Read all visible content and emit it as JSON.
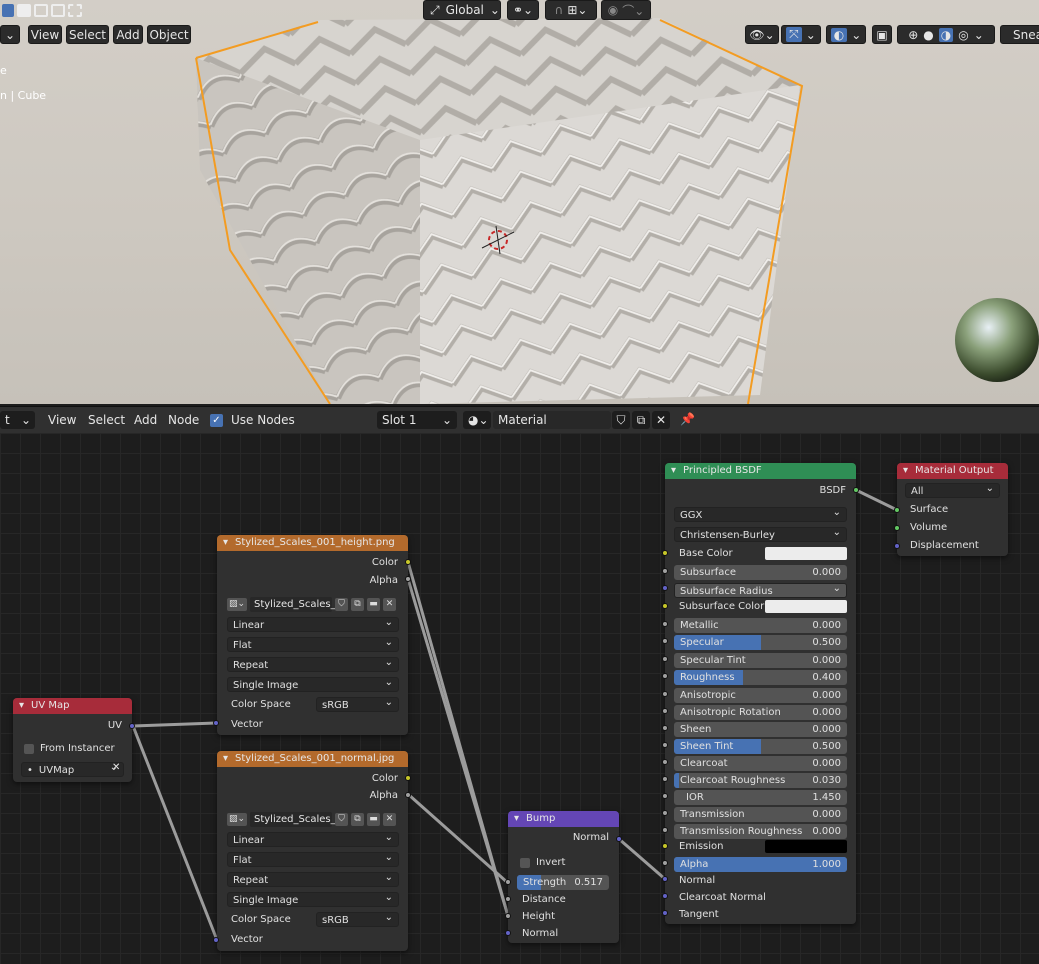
{
  "viewport": {
    "transform_orientation": "Global",
    "menu": [
      "View",
      "Select",
      "Add",
      "Object"
    ],
    "overlay_lines": [
      "e",
      "n | Cube"
    ],
    "shading_label": "Snea"
  },
  "editor": {
    "editor_type": "t",
    "menu": [
      "View",
      "Select",
      "Add",
      "Node"
    ],
    "use_nodes_label": "Use Nodes",
    "use_nodes_checked": true,
    "slot": "Slot 1",
    "material_name": "Material"
  },
  "nodes": {
    "uvmap": {
      "title": "UV Map",
      "out_uv": "UV",
      "from_instancer": "From Instancer",
      "uvmap_value": "UVMap"
    },
    "tex_height": {
      "title": "Stylized_Scales_001_height.png",
      "out_color": "Color",
      "out_alpha": "Alpha",
      "image": "Stylized_Scales_0..",
      "interpolation": "Linear",
      "projection": "Flat",
      "extension": "Repeat",
      "source": "Single Image",
      "color_space_label": "Color Space",
      "color_space": "sRGB",
      "in_vector": "Vector"
    },
    "tex_normal": {
      "title": "Stylized_Scales_001_normal.jpg",
      "out_color": "Color",
      "out_alpha": "Alpha",
      "image": "Stylized_Scales_0..",
      "interpolation": "Linear",
      "projection": "Flat",
      "extension": "Repeat",
      "source": "Single Image",
      "color_space_label": "Color Space",
      "color_space": "sRGB",
      "in_vector": "Vector"
    },
    "bump": {
      "title": "Bump",
      "out_normal": "Normal",
      "invert": "Invert",
      "strength_label": "Strength",
      "strength": "0.517",
      "strength_fraction": 0.517,
      "distance": "Distance",
      "height": "Height",
      "normal": "Normal"
    },
    "bsdf": {
      "title": "Principled BSDF",
      "out": "BSDF",
      "distribution": "GGX",
      "subsurface_method": "Christensen-Burley",
      "base_color": "Base Color",
      "subsurface": "Subsurface",
      "subsurface_val": "0.000",
      "subsurface_radius": "Subsurface Radius",
      "subsurface_color": "Subsurface Color",
      "metallic": "Metallic",
      "metallic_val": "0.000",
      "specular": "Specular",
      "specular_val": "0.500",
      "specular_tint": "Specular Tint",
      "specular_tint_val": "0.000",
      "roughness": "Roughness",
      "roughness_val": "0.400",
      "anisotropic": "Anisotropic",
      "anisotropic_val": "0.000",
      "aniso_rot": "Anisotropic Rotation",
      "aniso_rot_val": "0.000",
      "sheen": "Sheen",
      "sheen_val": "0.000",
      "sheen_tint": "Sheen Tint",
      "sheen_tint_val": "0.500",
      "clearcoat": "Clearcoat",
      "clearcoat_val": "0.000",
      "clearcoat_rough": "Clearcoat Roughness",
      "clearcoat_rough_val": "0.030",
      "ior": "IOR",
      "ior_val": "1.450",
      "transmission": "Transmission",
      "transmission_val": "0.000",
      "trans_rough": "Transmission Roughness",
      "trans_rough_val": "0.000",
      "emission": "Emission",
      "alpha": "Alpha",
      "alpha_val": "1.000",
      "normal": "Normal",
      "clearcoat_normal": "Clearcoat Normal",
      "tangent": "Tangent"
    },
    "output": {
      "title": "Material Output",
      "target": "All",
      "surface": "Surface",
      "volume": "Volume",
      "displacement": "Displacement"
    }
  },
  "colors": {
    "shader_header": "#2f8e55",
    "texture_header": "#b36a2c",
    "input_header": "#a72c3a",
    "vector_header": "#6446b5",
    "output_header": "#a72c3a",
    "selection": "#f39c22",
    "accent": "#4772b3"
  }
}
